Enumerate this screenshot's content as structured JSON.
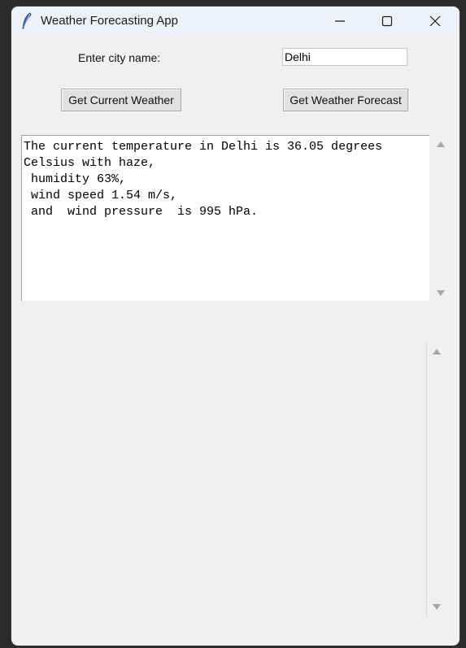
{
  "window": {
    "title": "Weather Forecasting App"
  },
  "form": {
    "city_label": "Enter city name:",
    "city_value": "Delhi",
    "current_button": "Get Current Weather",
    "forecast_button": "Get Weather Forecast"
  },
  "output": {
    "current_text": "The current temperature in Delhi is 36.05 degrees\nCelsius with haze,\n humidity 63%,\n wind speed 1.54 m/s,\n and  wind pressure  is 995 hPa.",
    "forecast_text": ""
  },
  "colors": {
    "window_bg": "#f0f0f0",
    "titlebar_bg": "#eef1f8",
    "icon_blue": "#2c5aa0"
  }
}
